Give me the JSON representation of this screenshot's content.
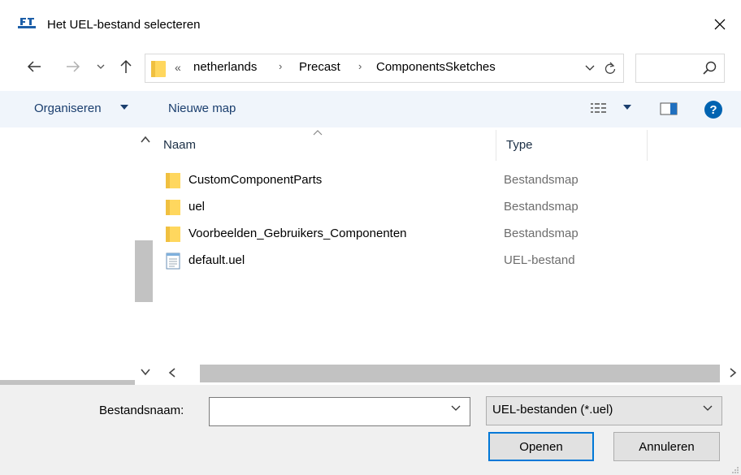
{
  "window": {
    "title": "Het UEL-bestand selecteren",
    "close_icon": "close-icon"
  },
  "nav": {
    "back_icon": "back-arrow-icon",
    "forward_icon": "forward-arrow-icon",
    "recent_icon": "chevron-down-icon",
    "up_icon": "up-arrow-icon",
    "overflow": "«",
    "breadcrumbs": [
      "netherlands",
      "Precast",
      "ComponentsSketches"
    ],
    "separator": "›",
    "search_placeholder": ""
  },
  "commandbar": {
    "organise_label": "Organiseren",
    "new_folder_label": "Nieuwe map"
  },
  "columns": {
    "name": "Naam",
    "type": "Type"
  },
  "files": [
    {
      "name": "CustomComponentParts",
      "type": "Bestandsmap",
      "icon": "folder-icon"
    },
    {
      "name": "uel",
      "type": "Bestandsmap",
      "icon": "folder-icon"
    },
    {
      "name": "Voorbeelden_Gebruikers_Componenten",
      "type": "Bestandsmap",
      "icon": "folder-icon"
    },
    {
      "name": "default.uel",
      "type": "UEL-bestand",
      "icon": "text-file-icon"
    }
  ],
  "bottom": {
    "filename_label": "Bestandsnaam:",
    "filename_value": "",
    "filter_value": "UEL-bestanden (*.uel)",
    "open_label": "Openen",
    "cancel_label": "Annuleren"
  },
  "colors": {
    "accent": "#0078d7",
    "folder": "#ffd75e",
    "commandbar_bg": "#f0f5fb"
  }
}
